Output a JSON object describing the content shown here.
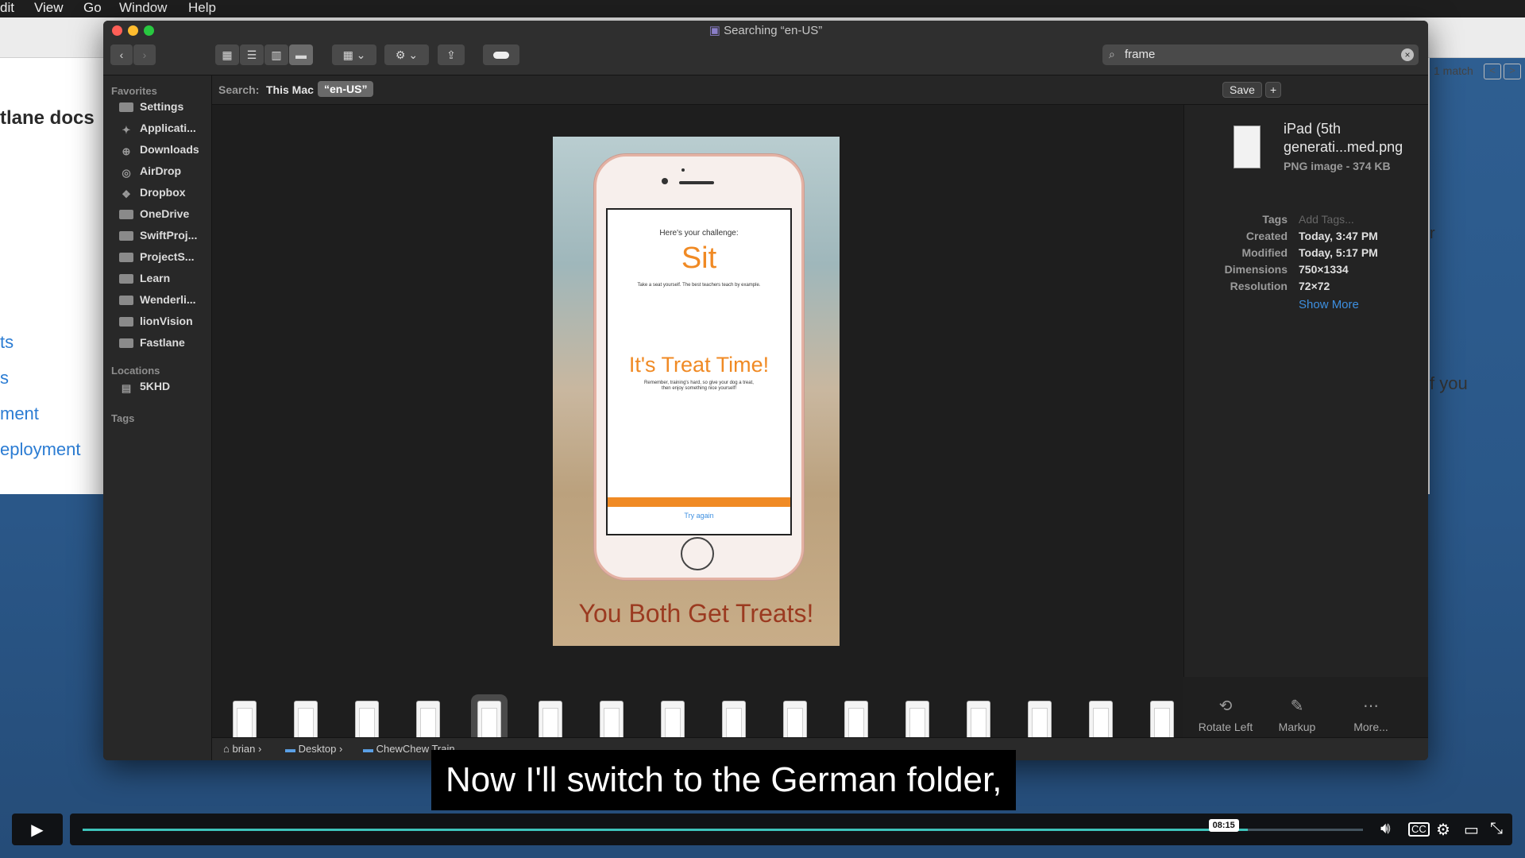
{
  "host_menubar": {
    "items": [
      "dit",
      "View",
      "Go",
      "Window",
      "Help"
    ]
  },
  "background_page": {
    "heading": "tlane docs",
    "links": [
      "ts",
      "s",
      "ment",
      "eployment"
    ],
    "right_fragments": [
      "r",
      "f you"
    ],
    "match_label": "1 match"
  },
  "finder": {
    "title": "Searching “en-US”",
    "search_value": "frame",
    "search_scope_label": "Search:",
    "scope_this_mac": "This Mac",
    "scope_selected": "“en-US”",
    "save_label": "Save",
    "add_label": "+",
    "sidebar": {
      "favorites_header": "Favorites",
      "favorites": [
        "Settings",
        "Applicati...",
        "Downloads",
        "AirDrop",
        "Dropbox",
        "OneDrive",
        "SwiftProj...",
        "ProjectS...",
        "Learn",
        "Wenderli...",
        "lionVision",
        "Fastlane"
      ],
      "locations_header": "Locations",
      "locations": [
        "5KHD"
      ],
      "tags_header": "Tags"
    },
    "inspector": {
      "filename_line1": "iPad (5th",
      "filename_line2": "generati...med.png",
      "kind": "PNG image - 374 KB",
      "rows": [
        {
          "key": "Tags",
          "value": "Add Tags..."
        },
        {
          "key": "Created",
          "value": "Today, 3:47 PM"
        },
        {
          "key": "Modified",
          "value": "Today, 5:17 PM"
        },
        {
          "key": "Dimensions",
          "value": "750×1334"
        },
        {
          "key": "Resolution",
          "value": "72×72"
        }
      ],
      "show_more": "Show More"
    },
    "actions": [
      "Rotate Left",
      "Markup",
      "More..."
    ],
    "path": [
      "brian",
      "Desktop",
      "ChewChew Train"
    ],
    "thumbnail_count": 16,
    "selected_thumbnail": 5
  },
  "preview": {
    "challenge": "Here's your challenge:",
    "command": "Sit",
    "command_sub": "Take a seat yourself. The best teachers teach by example.",
    "treat_title": "It's Treat Time!",
    "treat_sub_1": "Remember, training's hard, so give your dog a treat,",
    "treat_sub_2": "then enjoy something nice yourself!",
    "try_again": "Try again",
    "banner": "You Both Get Treats!"
  },
  "video": {
    "caption": "Now I'll switch to the German folder,",
    "time_badge": "08:15",
    "progress": 0.91,
    "accent": "#3ec3ba"
  }
}
